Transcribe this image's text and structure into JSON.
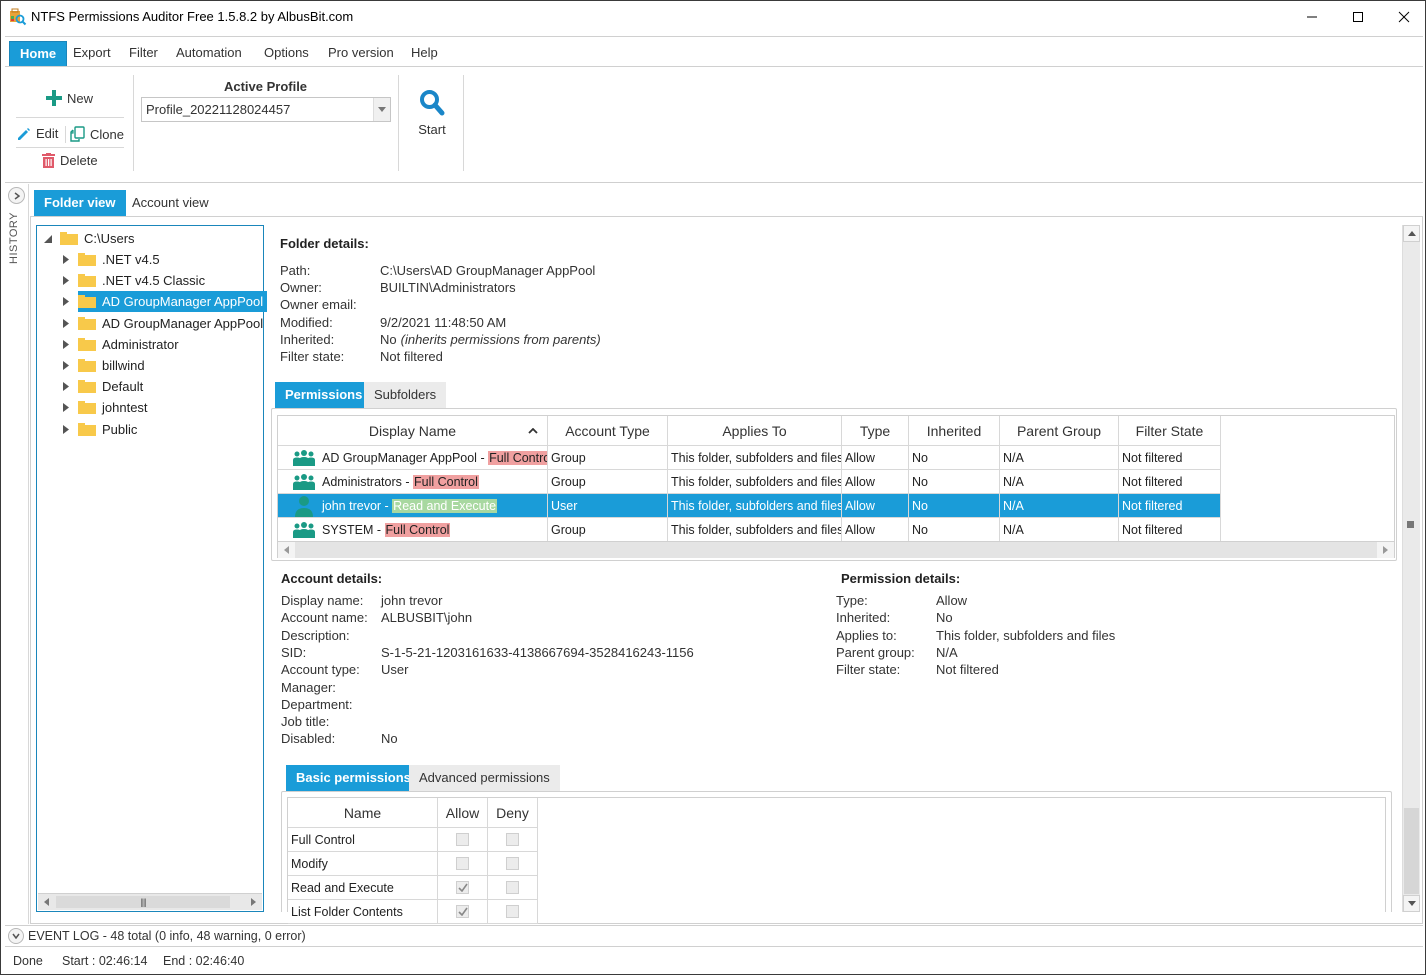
{
  "window": {
    "title": "NTFS Permissions Auditor Free 1.5.8.2 by AlbusBit.com",
    "controls": {
      "minimize": "minimize",
      "maximize": "maximize",
      "close": "close"
    }
  },
  "menu": {
    "items": [
      {
        "label": "Home",
        "active": true
      },
      {
        "label": "Export"
      },
      {
        "label": "Filter"
      },
      {
        "label": "Automation"
      },
      {
        "label": "Options"
      },
      {
        "label": "Pro version"
      },
      {
        "label": "Help"
      }
    ]
  },
  "ribbon": {
    "new_label": "New",
    "edit_label": "Edit",
    "clone_label": "Clone",
    "delete_label": "Delete",
    "profile_label": "Active Profile",
    "profile_value": "Profile_20221128024457",
    "start_label": "Start"
  },
  "history": {
    "label": "HISTORY"
  },
  "view_tabs": [
    {
      "label": "Folder view",
      "active": true
    },
    {
      "label": "Account view"
    }
  ],
  "tree": {
    "root": "C:\\Users",
    "children": [
      {
        "label": ".NET v4.5"
      },
      {
        "label": ".NET v4.5 Classic"
      },
      {
        "label": "AD GroupManager AppPool",
        "selected": true
      },
      {
        "label": "AD GroupManager AppPool"
      },
      {
        "label": "Administrator"
      },
      {
        "label": "billwind"
      },
      {
        "label": "Default"
      },
      {
        "label": "johntest"
      },
      {
        "label": "Public"
      }
    ]
  },
  "folder_details": {
    "title": "Folder details:",
    "fields": [
      {
        "key": "Path:",
        "value": "C:\\Users\\AD GroupManager AppPool"
      },
      {
        "key": "Owner:",
        "value": "BUILTIN\\Administrators"
      },
      {
        "key": "Owner email:",
        "value": ""
      },
      {
        "key": "Modified:",
        "value": "9/2/2021 11:48:50 AM"
      },
      {
        "key": "Inherited:",
        "value": "No",
        "note": "(inherits permissions from parents)"
      },
      {
        "key": "Filter state:",
        "value": "Not filtered"
      }
    ]
  },
  "detail_tabs": [
    {
      "label": "Permissions",
      "active": true
    },
    {
      "label": "Subfolders"
    }
  ],
  "permissions_grid": {
    "columns": [
      "Display Name",
      "Account Type",
      "Applies To",
      "Type",
      "Inherited",
      "Parent Group",
      "Filter State"
    ],
    "sort_column": "Display Name",
    "sort_direction": "ascending",
    "rows": [
      {
        "icon": "group",
        "name": "AD GroupManager AppPool",
        "right": "Full Control",
        "right_color": "red",
        "account_type": "Group",
        "applies_to": "This folder, subfolders and files",
        "type": "Allow",
        "inherited": "No",
        "parent_group": "N/A",
        "filter_state": "Not filtered"
      },
      {
        "icon": "group",
        "name": "Administrators",
        "right": "Full Control",
        "right_color": "red",
        "account_type": "Group",
        "applies_to": "This folder, subfolders and files",
        "type": "Allow",
        "inherited": "No",
        "parent_group": "N/A",
        "filter_state": "Not filtered"
      },
      {
        "icon": "user",
        "name": "john trevor",
        "right": "Read and Execute",
        "right_color": "green",
        "account_type": "User",
        "applies_to": "This folder, subfolders and files",
        "type": "Allow",
        "inherited": "No",
        "parent_group": "N/A",
        "filter_state": "Not filtered",
        "selected": true
      },
      {
        "icon": "group",
        "name": "SYSTEM",
        "right": "Full Control",
        "right_color": "red",
        "account_type": "Group",
        "applies_to": "This folder, subfolders and files",
        "type": "Allow",
        "inherited": "No",
        "parent_group": "N/A",
        "filter_state": "Not filtered"
      }
    ]
  },
  "account_details": {
    "title": "Account details:",
    "fields": [
      {
        "key": "Display name:",
        "value": "john trevor"
      },
      {
        "key": "Account name:",
        "value": "ALBUSBIT\\john"
      },
      {
        "key": "Description:",
        "value": ""
      },
      {
        "key": "SID:",
        "value": "S-1-5-21-1203161633-4138667694-3528416243-1156"
      },
      {
        "key": "Account type:",
        "value": "User"
      },
      {
        "key": "Manager:",
        "value": ""
      },
      {
        "key": "Department:",
        "value": ""
      },
      {
        "key": "Job title:",
        "value": ""
      },
      {
        "key": "Disabled:",
        "value": "No"
      }
    ]
  },
  "permission_details": {
    "title": "Permission details:",
    "fields": [
      {
        "key": "Type:",
        "value": "Allow"
      },
      {
        "key": "Inherited:",
        "value": "No"
      },
      {
        "key": "Applies to:",
        "value": "This folder, subfolders and files"
      },
      {
        "key": "Parent group:",
        "value": "N/A"
      },
      {
        "key": "Filter state:",
        "value": "Not filtered"
      }
    ]
  },
  "perm_tabs": [
    {
      "label": "Basic permissions",
      "active": true
    },
    {
      "label": "Advanced permissions"
    }
  ],
  "basic_permissions": {
    "columns": [
      "Name",
      "Allow",
      "Deny"
    ],
    "rows": [
      {
        "name": "Full Control",
        "allow": false,
        "deny": false
      },
      {
        "name": "Modify",
        "allow": false,
        "deny": false
      },
      {
        "name": "Read and Execute",
        "allow": true,
        "deny": false
      },
      {
        "name": "List Folder Contents",
        "allow": true,
        "deny": false
      }
    ]
  },
  "event_log": {
    "text": "EVENT LOG - 48 total (0 info, 48 warning, 0 error)"
  },
  "status": {
    "state": "Done",
    "start": "Start :  02:46:14",
    "end": "End :  02:46:40"
  },
  "colors": {
    "accent": "#1a9cd8",
    "highlight_red": "#f0a0a0",
    "highlight_green": "#a8d8a0",
    "icon_teal": "#1a9a85",
    "folder_yellow": "#f8c94a",
    "delete_red": "#e05a6a"
  }
}
